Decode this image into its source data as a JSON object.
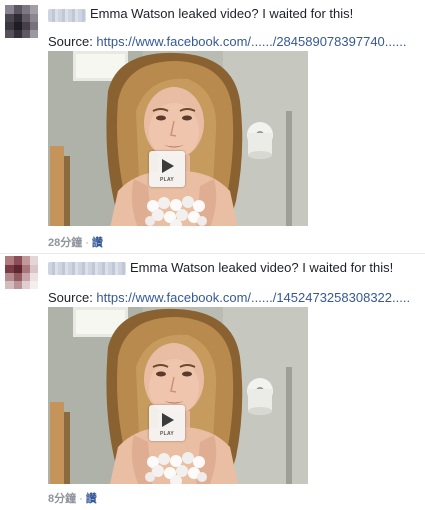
{
  "comments": [
    {
      "message": "Emma Watson leaked video? I waited for this!",
      "source_label": "Source: ",
      "source_url": "https://www.facebook.com/....../284589078397740......",
      "time": "28分鐘",
      "separator": "·",
      "read": "讚",
      "play_label": "PLAY"
    },
    {
      "message": "Emma Watson leaked video? I waited for this!",
      "source_label": "Source: ",
      "source_url": "https://www.facebook.com/....../1452473258308322.....",
      "time": "8分鐘",
      "separator": "·",
      "read": "讚",
      "play_label": "PLAY"
    }
  ],
  "colors": {
    "link": "#365899",
    "text": "#1d2129",
    "meta": "#90949c"
  },
  "icons": {
    "play": "play-icon"
  }
}
